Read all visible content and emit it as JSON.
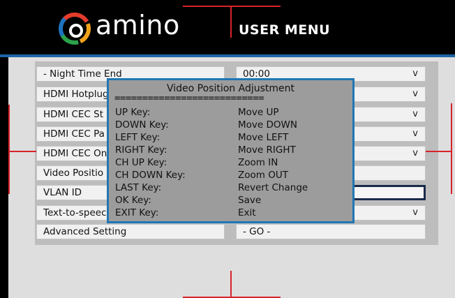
{
  "header": {
    "logo_text": "amino",
    "title": "USER MENU",
    "colors": {
      "accent_red": "#d8232a",
      "accent_blue": "#1c64a8"
    }
  },
  "menu": {
    "rows": [
      {
        "label": "- Night Time End",
        "value": "00:00",
        "dropdown": true
      },
      {
        "label": "HDMI Hotplug",
        "value": "",
        "dropdown": true
      },
      {
        "label": "HDMI CEC St",
        "value": "",
        "dropdown": true
      },
      {
        "label": "HDMI CEC Pa",
        "value": "",
        "dropdown": true
      },
      {
        "label": "HDMI CEC On",
        "value": "",
        "dropdown": true
      },
      {
        "label": "Video Positio",
        "value": "",
        "dropdown": false
      },
      {
        "label": "VLAN ID",
        "value": "",
        "dropdown": false,
        "selected": true
      },
      {
        "label": "Text-to-speec",
        "value": "",
        "dropdown": true
      },
      {
        "label": "Advanced Setting",
        "value": "- GO -",
        "dropdown": false
      }
    ],
    "dropdown_glyph": "v"
  },
  "dialog": {
    "title": "Video Position Adjustment",
    "separator": "===========================",
    "keys": [
      {
        "key": "UP Key:",
        "action": "Move UP"
      },
      {
        "key": "DOWN Key:",
        "action": "Move DOWN"
      },
      {
        "key": "LEFT Key:",
        "action": "Move LEFT"
      },
      {
        "key": "RIGHT Key:",
        "action": "Move RIGHT"
      },
      {
        "key": "CH UP Key:",
        "action": "Zoom IN"
      },
      {
        "key": "CH DOWN Key:",
        "action": "Zoom OUT"
      },
      {
        "key": "LAST Key:",
        "action": "Revert Change"
      },
      {
        "key": "OK Key:",
        "action": "Save"
      },
      {
        "key": "EXIT Key:",
        "action": "Exit"
      }
    ]
  }
}
